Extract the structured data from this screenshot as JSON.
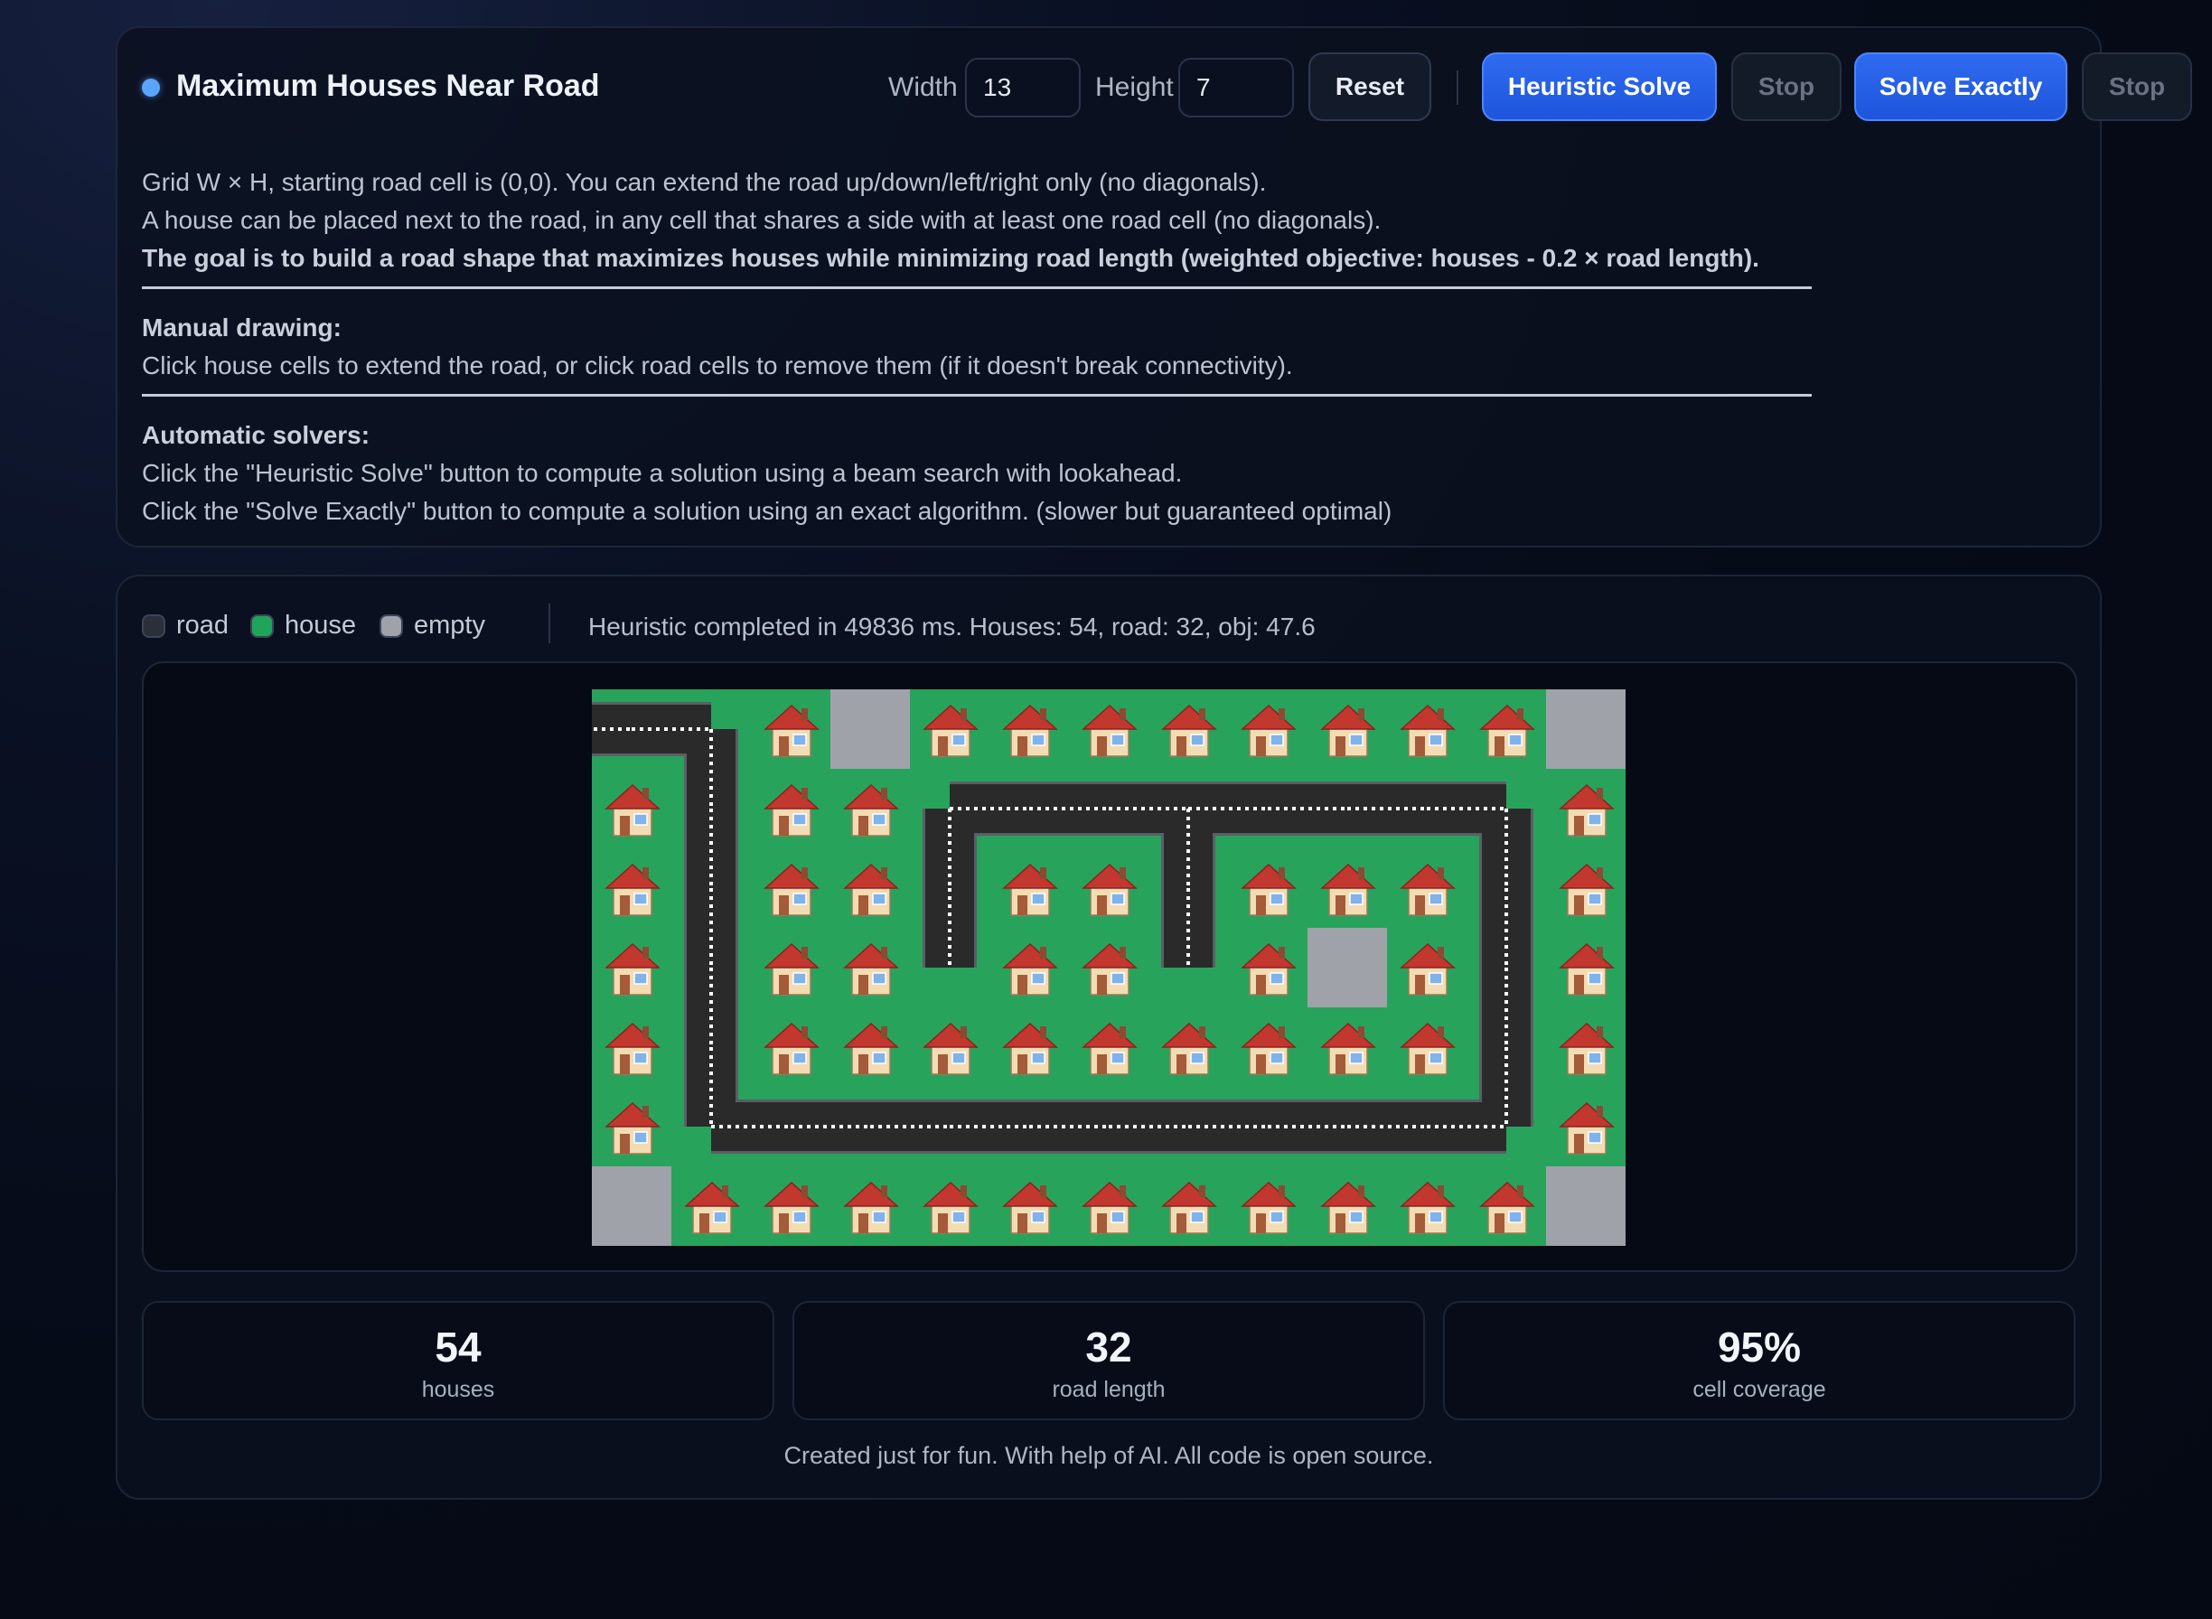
{
  "header": {
    "title": "Maximum Houses Near Road",
    "width_label": "Width",
    "width_value": "13",
    "height_label": "Height",
    "height_value": "7",
    "reset_label": "Reset",
    "heuristic_label": "Heuristic Solve",
    "stop_label": "Stop",
    "exact_label": "Solve Exactly",
    "stop2_label": "Stop"
  },
  "description": {
    "line1": "Grid W × H, starting road cell is (0,0). You can extend the road up/down/left/right only (no diagonals).",
    "line2": "A house can be placed next to the road, in any cell that shares a side with at least one road cell (no diagonals).",
    "line3": "The goal is to build a road shape that maximizes houses while minimizing road length (weighted objective: houses - 0.2 × road length).",
    "manual_title": "Manual drawing:",
    "manual_text": "Click house cells to extend the road, or click road cells to remove them (if it doesn't break connectivity).",
    "auto_title": "Automatic solvers:",
    "auto_line1": "Click the \"Heuristic Solve\" button to compute a solution using a beam search with lookahead.",
    "auto_line2": "Click the \"Solve Exactly\" button to compute a solution using an exact algorithm. (slower but guaranteed optimal)"
  },
  "legend": {
    "road": "road",
    "house": "house",
    "empty": "empty",
    "road_color": "#2b2f38",
    "house_color": "#1fa55a",
    "empty_color": "#a0a2aa"
  },
  "status": "Heuristic completed in 49836 ms. Houses: 54, road: 32, obj: 47.6",
  "grid": {
    "cols": 13,
    "rows": 7,
    "colors": {
      "grass": "#28a35c",
      "road": "#2a2a2a",
      "road_edge": "#5a5e66",
      "empty": "#a0a2aa",
      "dash": "#ffffff"
    },
    "cells": [
      "RRHEHHHHHHHHE",
      "HRHHRRRRRRRRH",
      "HRHHRHHRHHHRH",
      "HRHHRHHRHEHRH",
      "HRHHHHHHHHHRH",
      "HRRRRRRRRRRRH",
      "EHHHHHHHHHHHE"
    ]
  },
  "stats": [
    {
      "value": "54",
      "label": "houses"
    },
    {
      "value": "32",
      "label": "road length"
    },
    {
      "value": "95%",
      "label": "cell coverage"
    }
  ],
  "footer": "Created just for fun. With help of AI. All code is open source."
}
